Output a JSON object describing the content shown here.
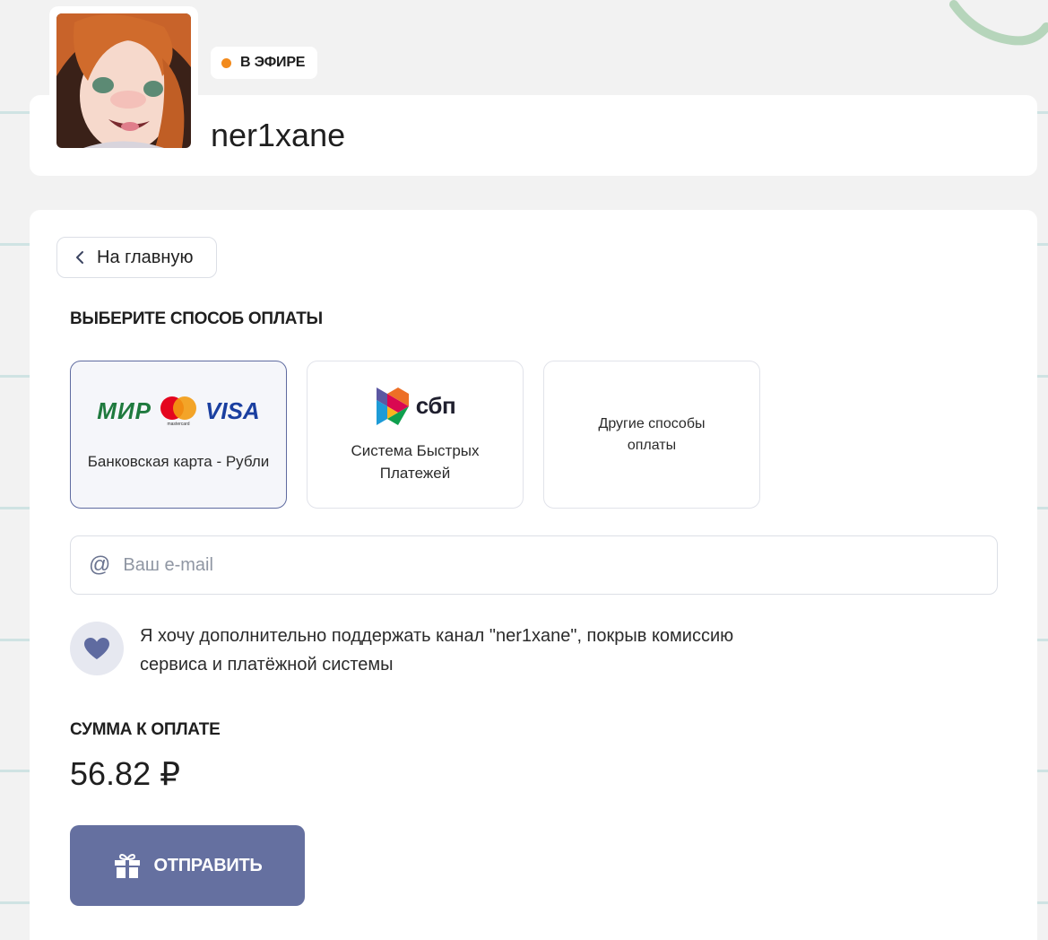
{
  "header": {
    "live_badge": "В ЭФИРЕ",
    "channel_name": "ner1xane"
  },
  "navigation": {
    "back_label": "На главную"
  },
  "payment": {
    "section_title": "ВЫБЕРИТЕ СПОСОБ ОПЛАТЫ",
    "options": [
      {
        "label": "Банковская карта - Рубли",
        "logos": [
          "МИР",
          "mastercard",
          "VISA"
        ],
        "selected": true
      },
      {
        "label_line1": "Система Быстрых",
        "label_line2": "Платежей",
        "logo": "сбп",
        "selected": false
      },
      {
        "label_line1": "Другие способы",
        "label_line2": "оплаты",
        "selected": false
      }
    ]
  },
  "email": {
    "placeholder": "Ваш e-mail",
    "value": ""
  },
  "support": {
    "text": "Я хочу дополнительно поддержать канал \"ner1xane\", покрыв комиссию сервиса и платёжной системы"
  },
  "amount": {
    "title": "СУММА К ОПЛАТЕ",
    "value": "56.82 ₽"
  },
  "submit": {
    "label": "ОТПРАВИТЬ"
  },
  "colors": {
    "accent": "#6570a0",
    "live_dot": "#f28a1c",
    "selected_border": "#5f6ba0"
  },
  "icons": [
    "chevron-left-icon",
    "at-icon",
    "heart-icon",
    "gift-icon"
  ]
}
